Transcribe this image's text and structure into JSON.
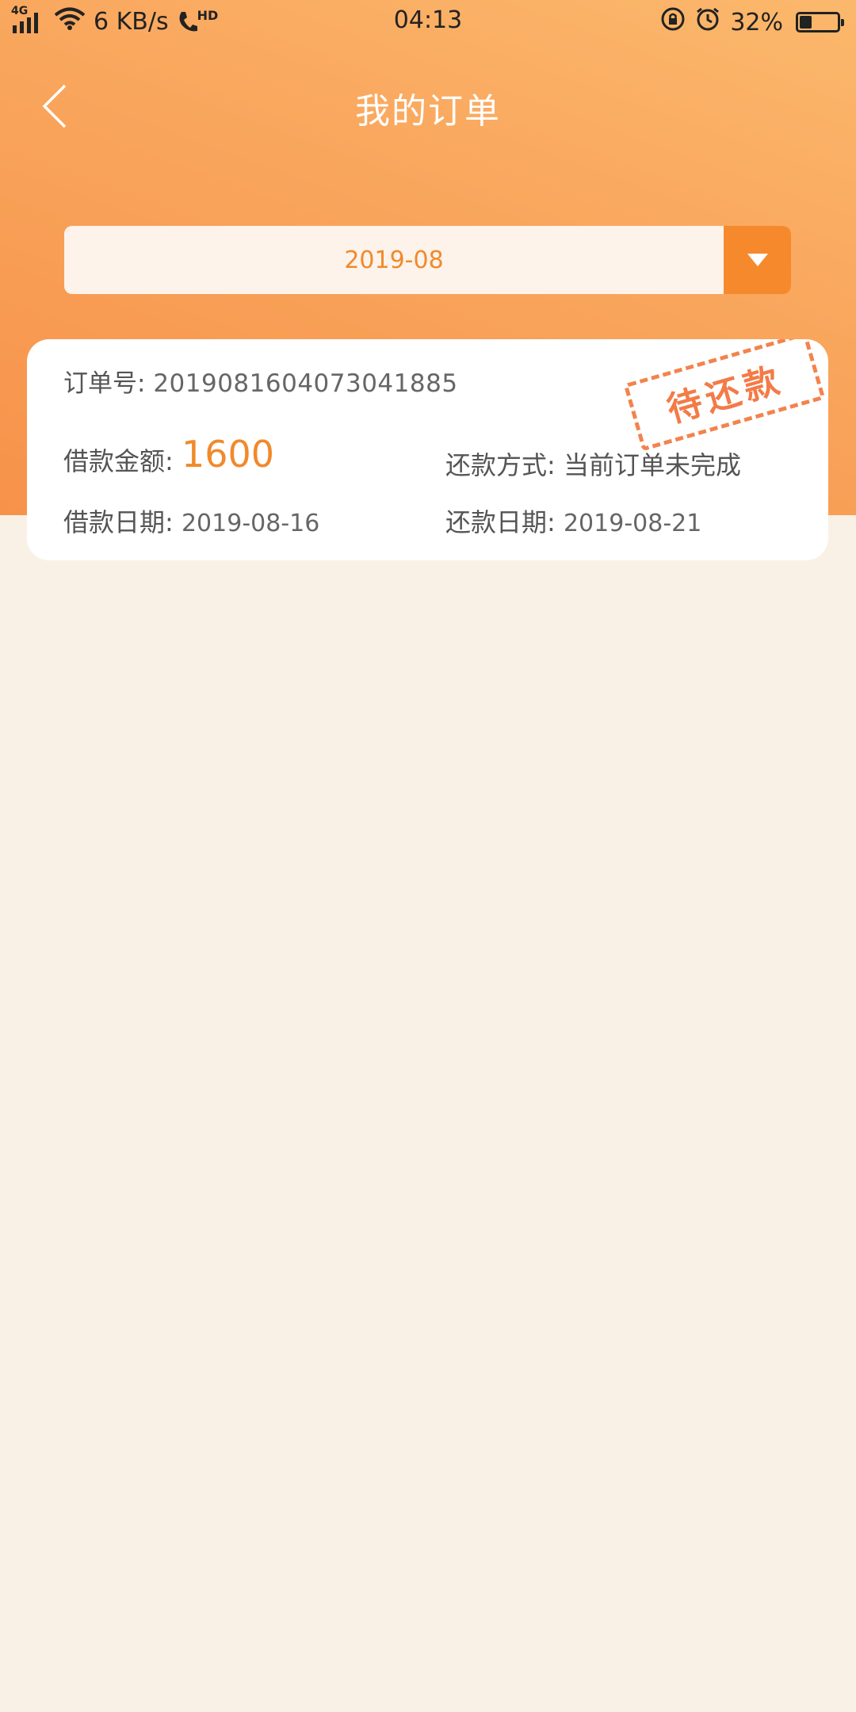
{
  "status_bar": {
    "network": "4G",
    "speed": "6 KB/s",
    "hd": "HD",
    "time": "04:13",
    "battery": "32%",
    "battery_level": 0.32
  },
  "nav": {
    "title": "我的订单"
  },
  "month_selector": {
    "value": "2019-08"
  },
  "order": {
    "order_no_label": "订单号:",
    "order_no": "2019081604073041885",
    "stamp": "待还款",
    "amount_label": "借款金额:",
    "amount": "1600",
    "repay_method_label": "还款方式:",
    "repay_method": "当前订单未完成",
    "loan_date_label": "借款日期:",
    "loan_date": "2019-08-16",
    "repay_date_label": "还款日期:",
    "repay_date": "2019-08-21"
  },
  "colors": {
    "accent": "#f08a2c",
    "header_gradient_start": "#fbb86c",
    "header_gradient_end": "#f7924a",
    "page_bg": "#faf1e6",
    "stamp": "#f26d34"
  }
}
